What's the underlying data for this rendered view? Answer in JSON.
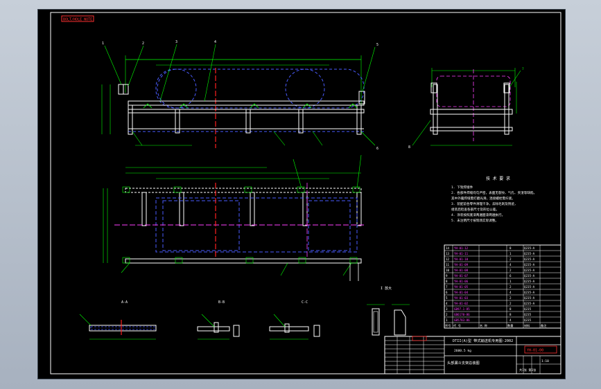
{
  "drawing": {
    "title_tag": "BOLT/HOLE NOTE",
    "tech_req_title": "技 术 要 求",
    "tech_req": [
      "1. 下架焊接件",
      "2. 各部件焊缝均匀严密，表面无裂纹、气孔、夹渣等缺陷，",
      "   其中外露焊缝需打磨光滑，连接螺栓需拧紧。",
      "3. 装配前各零件清理干净，去除毛刺及锈迹，",
      "   组装后检查各部尺寸及形位公差。",
      "4. 涂装按照底漆两遍面漆两遍执行。",
      "5. 未注明尺寸按现场实际调整。"
    ],
    "section_labels": [
      "A-A",
      "B-B",
      "C-C"
    ],
    "detail_label": "I 放大",
    "part_callouts_front": [
      "1",
      "2",
      "3",
      "4",
      "5",
      "6"
    ],
    "part_callouts_side": [
      "7",
      "8",
      "9"
    ],
    "title_block": {
      "rows": [
        {
          "no": "1",
          "name": "GB5783-86",
          "qty": "4",
          "mat": "Q235"
        },
        {
          "no": "2",
          "name": "GB6170-86",
          "qty": "8",
          "mat": "Q235"
        },
        {
          "no": "3",
          "name": "GB97.1-85",
          "qty": "8",
          "mat": "Q235"
        },
        {
          "no": "4",
          "name": "YH-01-02",
          "qty": "2",
          "mat": "Q235-A"
        },
        {
          "no": "5",
          "name": "YH-01-03",
          "qty": "2",
          "mat": "Q235-A"
        },
        {
          "no": "6",
          "name": "YH-01-04",
          "qty": "4",
          "mat": "Q235-A"
        },
        {
          "no": "7",
          "name": "YH-01-05",
          "qty": "2",
          "mat": "Q235-A"
        },
        {
          "no": "8",
          "name": "YH-01-06",
          "qty": "1",
          "mat": "Q235-A"
        },
        {
          "no": "9",
          "name": "YH-01-07",
          "qty": "6",
          "mat": "Q235-A"
        },
        {
          "no": "10",
          "name": "YH-01-08",
          "qty": "2",
          "mat": "Q235-A"
        },
        {
          "no": "11",
          "name": "YH-01-09",
          "qty": "4",
          "mat": "Q235-A"
        },
        {
          "no": "12",
          "name": "YH-01-10",
          "qty": "2",
          "mat": "Q235-A"
        },
        {
          "no": "13",
          "name": "YH-01-11",
          "qty": "1",
          "mat": "Q235-A"
        },
        {
          "no": "14",
          "name": "YH-01-12",
          "qty": "8",
          "mat": "Q235-A"
        }
      ],
      "header": [
        "序号",
        "代  号",
        "名  称",
        "数量",
        "材料",
        "备注"
      ],
      "machine_name": "DTII(A)型 带式输送机专用图-2002",
      "drawing_no": "YH-01-00",
      "part_name": "头部漏斗支架总装图",
      "scale_text": "1:10",
      "weight_text": "2600.5 kg",
      "sheet_text": "共1张 第1张"
    }
  }
}
